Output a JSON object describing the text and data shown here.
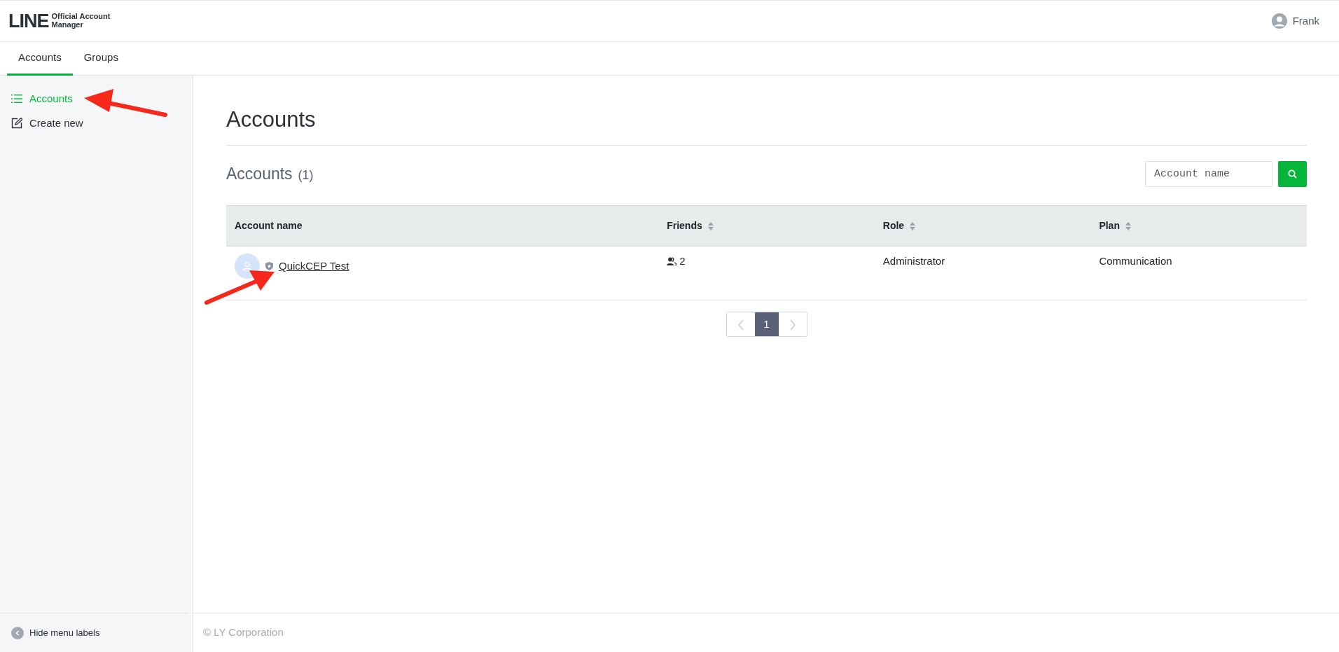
{
  "header": {
    "logo": {
      "wordmark": "LINE",
      "line1": "Official Account",
      "line2": "Manager"
    },
    "user": "Frank"
  },
  "tabs": [
    {
      "label": "Accounts",
      "selected": true
    },
    {
      "label": "Groups",
      "selected": false
    }
  ],
  "sidebar": {
    "items": [
      {
        "label": "Accounts",
        "kind": "list",
        "selected": true
      },
      {
        "label": "Create new",
        "kind": "edit",
        "selected": false
      }
    ],
    "collapse": "Hide menu labels"
  },
  "page_title": "Accounts",
  "section": {
    "title": "Accounts",
    "count": "(1)"
  },
  "search": {
    "placeholder": "Account name"
  },
  "table": {
    "columns": [
      {
        "label": "Account name",
        "sortable": false
      },
      {
        "label": "Friends",
        "sortable": true
      },
      {
        "label": "Role",
        "sortable": true
      },
      {
        "label": "Plan",
        "sortable": true
      }
    ],
    "rows": [
      {
        "name": "QuickCEP Test",
        "friends": "2",
        "role": "Administrator",
        "plan": "Communication"
      }
    ]
  },
  "pagination": {
    "pages": [
      {
        "label": "1",
        "selected": true
      }
    ]
  },
  "footer": "© LY Corporation"
}
